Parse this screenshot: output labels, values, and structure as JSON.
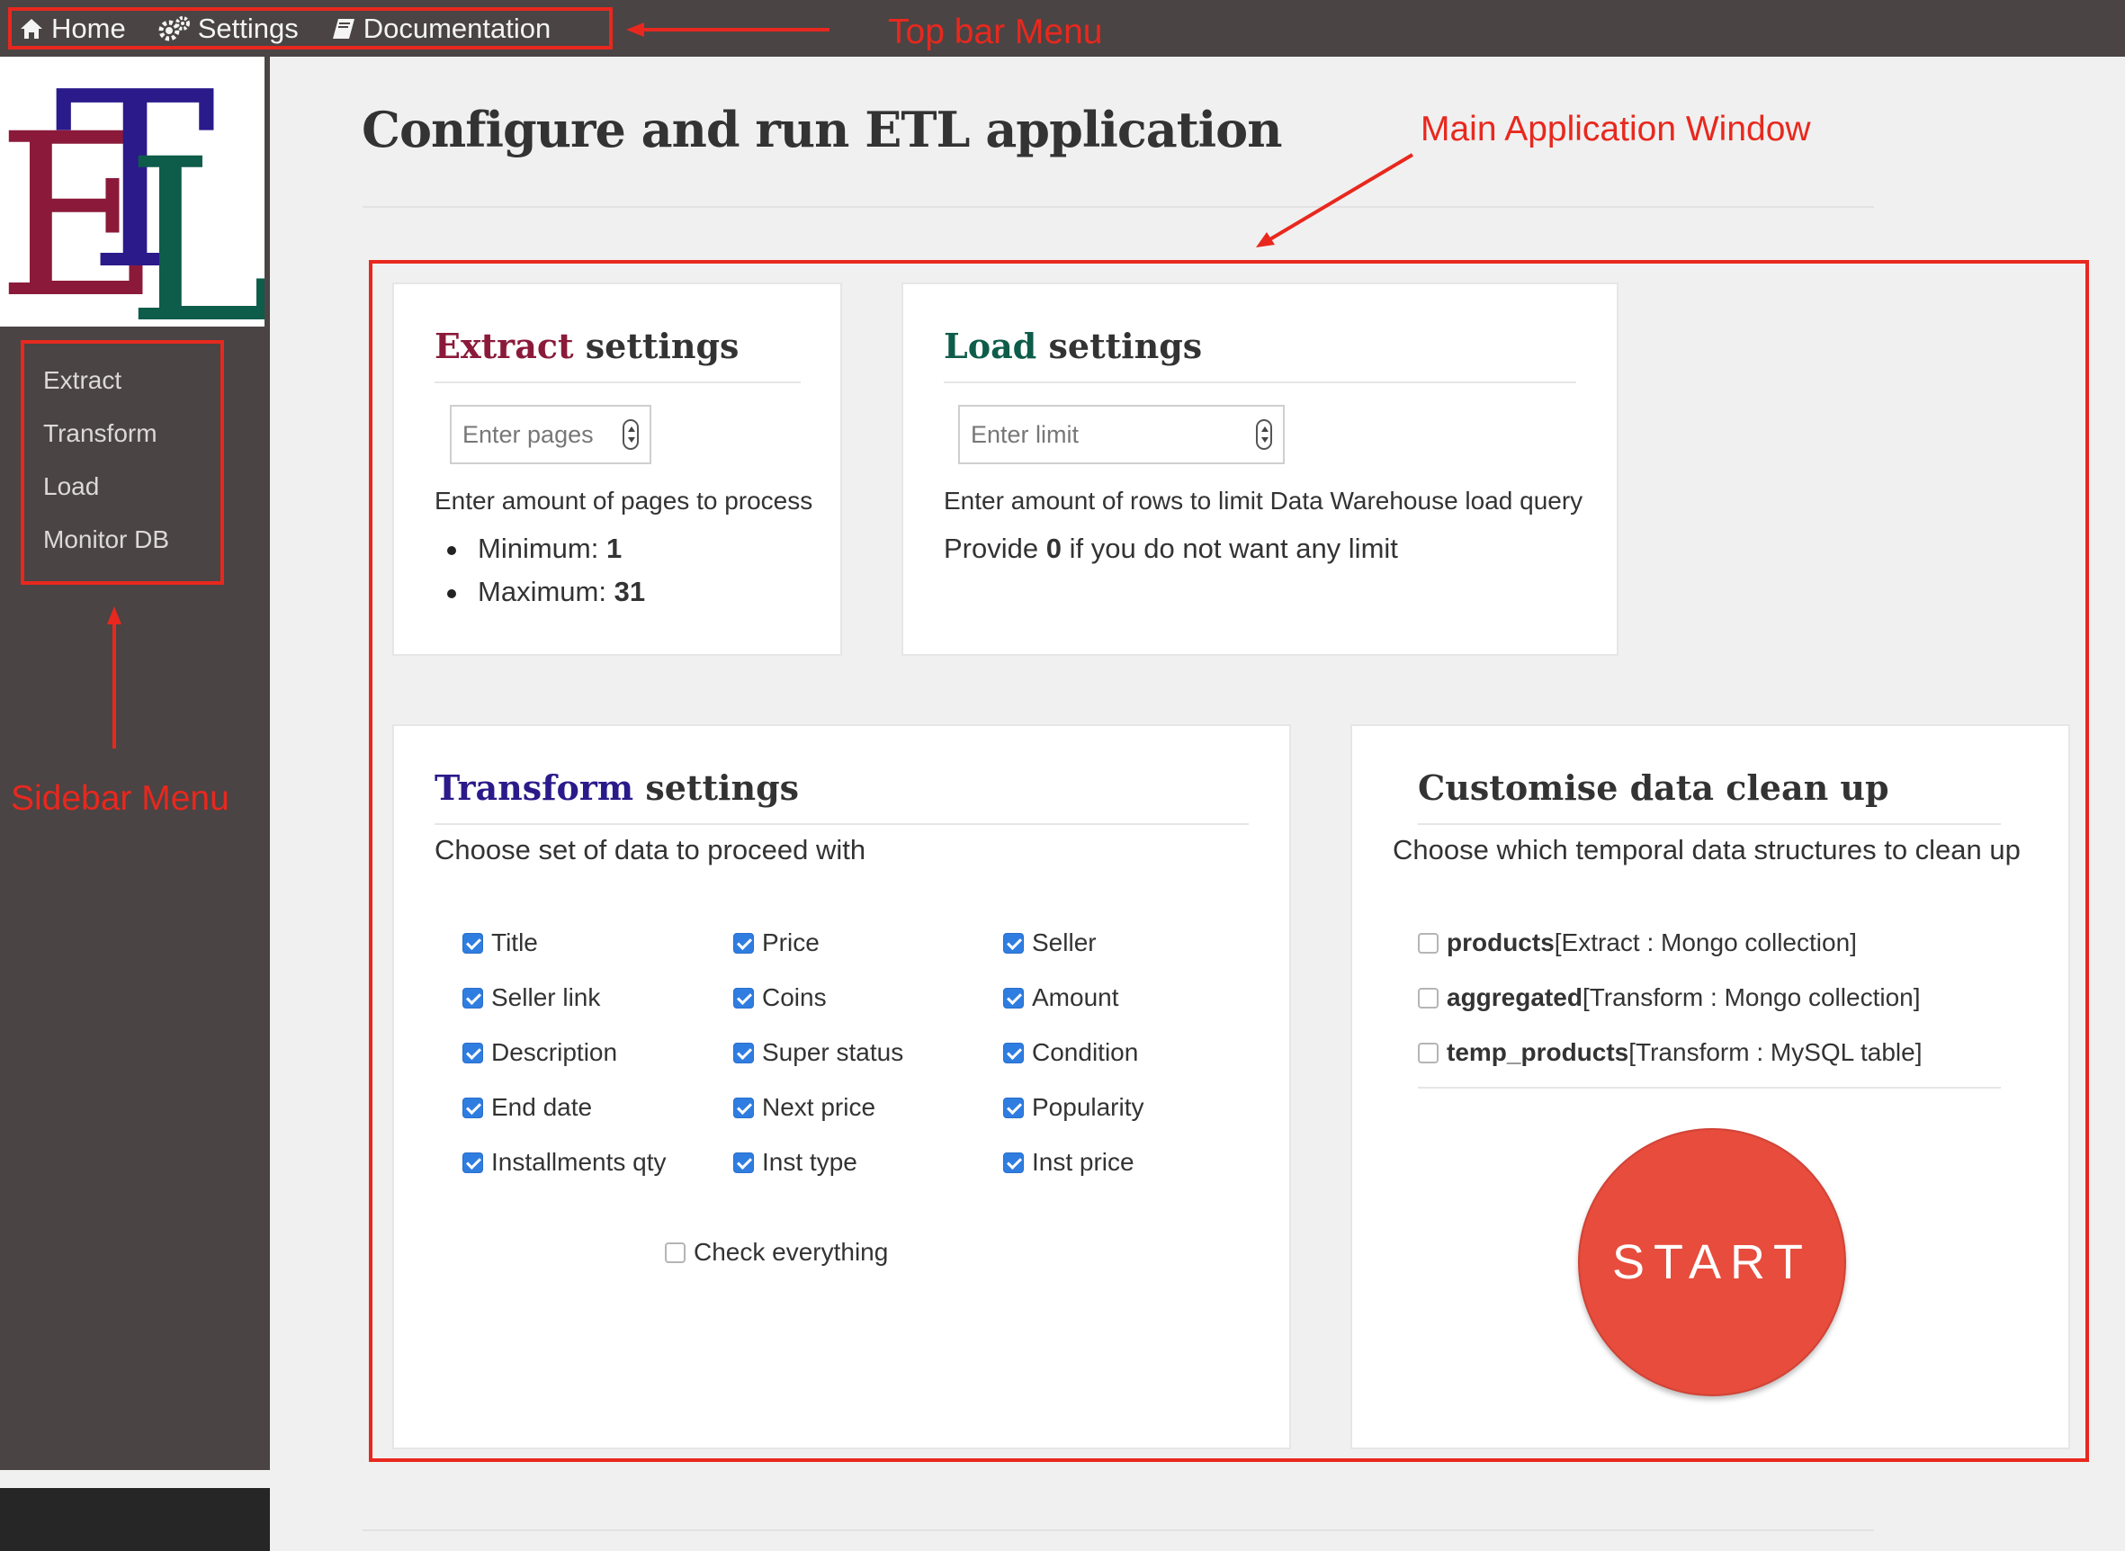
{
  "topbar": {
    "items": [
      {
        "label": "Home",
        "icon": "home-icon"
      },
      {
        "label": "Settings",
        "icon": "gears-icon"
      },
      {
        "label": "Documentation",
        "icon": "book-icon"
      }
    ]
  },
  "logo": {
    "text": "ETL",
    "colors": {
      "E": "#8b1a3a",
      "T": "#2a1a8a",
      "L": "#0e5c4a"
    }
  },
  "sidebar": {
    "items": [
      {
        "label": "Extract"
      },
      {
        "label": "Transform"
      },
      {
        "label": "Load"
      },
      {
        "label": "Monitor DB"
      }
    ]
  },
  "annotations": {
    "topbar": "Top bar Menu",
    "main": "Main Application Window",
    "sidebar": "Sidebar Menu",
    "color": "#e8281e"
  },
  "page": {
    "title": "Configure and run ETL application"
  },
  "extract": {
    "title_accent": "Extract",
    "title_rest": " settings",
    "accent_color": "#8b1a3a",
    "input_placeholder": "Enter pages",
    "description": "Enter amount of pages to process",
    "min_label": "Minimum: ",
    "min_value": "1",
    "max_label": "Maximum: ",
    "max_value": "31"
  },
  "load": {
    "title_accent": "Load",
    "title_rest": " settings",
    "accent_color": "#0e5c4a",
    "input_placeholder": "Enter limit",
    "description": "Enter amount of rows to limit Data Warehouse load query",
    "hint_pre": "Provide ",
    "hint_bold": "0",
    "hint_post": " if you do not want any limit"
  },
  "transform": {
    "title_accent": "Transform",
    "title_rest": " settings",
    "accent_color": "#2a1a8a",
    "subtitle": "Choose set of data to proceed with",
    "fields": [
      {
        "label": "Title",
        "checked": true
      },
      {
        "label": "Price",
        "checked": true
      },
      {
        "label": "Seller",
        "checked": true
      },
      {
        "label": "Seller link",
        "checked": true
      },
      {
        "label": "Coins",
        "checked": true
      },
      {
        "label": "Amount",
        "checked": true
      },
      {
        "label": "Description",
        "checked": true
      },
      {
        "label": "Super status",
        "checked": true
      },
      {
        "label": "Condition",
        "checked": true
      },
      {
        "label": "End date",
        "checked": true
      },
      {
        "label": "Next price",
        "checked": true
      },
      {
        "label": "Popularity",
        "checked": true
      },
      {
        "label": "Installments qty",
        "checked": true
      },
      {
        "label": "Inst type",
        "checked": true
      },
      {
        "label": "Inst price",
        "checked": true
      }
    ],
    "check_all": {
      "label": "Check everything",
      "checked": false
    }
  },
  "cleanup": {
    "title": "Customise data clean up",
    "subtitle": "Choose which temporal data structures to clean up",
    "items": [
      {
        "name": "products",
        "detail": " [Extract : Mongo collection]",
        "checked": false
      },
      {
        "name": "aggregated",
        "detail": " [Transform : Mongo collection]",
        "checked": false
      },
      {
        "name": "temp_products",
        "detail": " [Transform : MySQL table]",
        "checked": false
      }
    ]
  },
  "start_button": {
    "label": "START",
    "color": "#e74c3c"
  }
}
